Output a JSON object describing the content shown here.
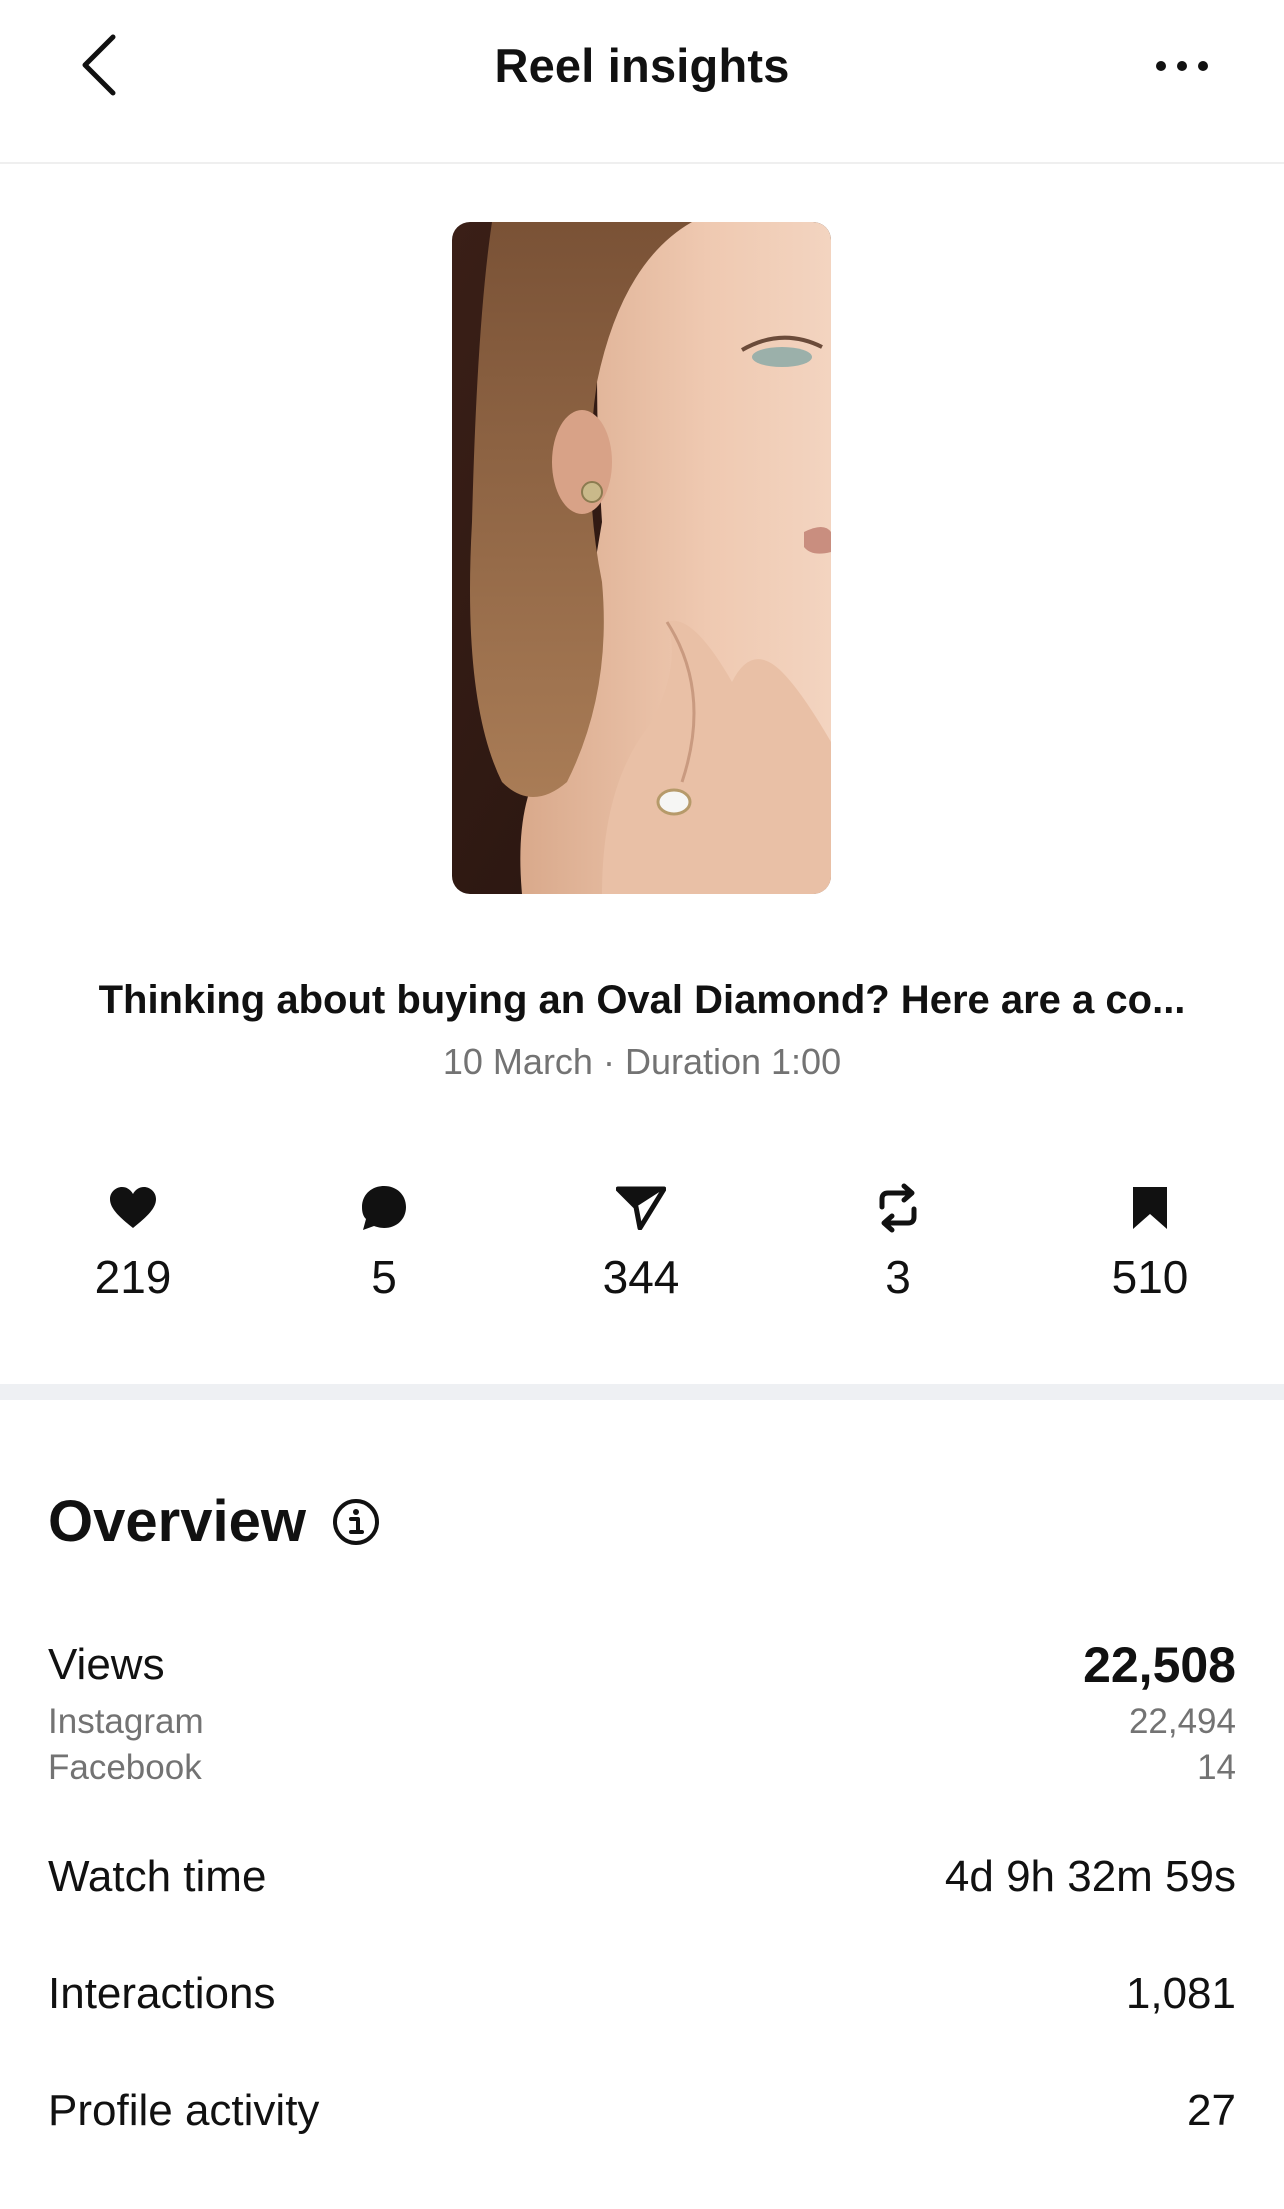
{
  "header": {
    "title": "Reel insights",
    "back_icon": "chevron-left-icon",
    "more_icon": "more-horizontal-icon"
  },
  "reel": {
    "thumbnail_alt": "woman-wearing-diamond-earring-and-ring",
    "caption": "Thinking about buying an Oval Diamond? Here are a co...",
    "meta": "10 March · Duration 1:00"
  },
  "stats": [
    {
      "icon": "heart-icon",
      "value": "219"
    },
    {
      "icon": "comment-icon",
      "value": "5"
    },
    {
      "icon": "share-icon",
      "value": "344"
    },
    {
      "icon": "repost-icon",
      "value": "3"
    },
    {
      "icon": "bookmark-icon",
      "value": "510"
    }
  ],
  "overview": {
    "title": "Overview",
    "info_icon": "info-icon",
    "views": {
      "label": "Views",
      "value": "22,508",
      "breakdown": [
        {
          "label": "Instagram",
          "value": "22,494"
        },
        {
          "label": "Facebook",
          "value": "14"
        }
      ]
    },
    "watch_time": {
      "label": "Watch time",
      "value": "4d 9h 32m 59s"
    },
    "interactions": {
      "label": "Interactions",
      "value": "1,081"
    },
    "profile_activity": {
      "label": "Profile activity",
      "value": "27"
    }
  },
  "colors": {
    "text": "#111111",
    "secondary_text": "#737373",
    "divider": "#eef0f3",
    "background": "#ffffff"
  }
}
